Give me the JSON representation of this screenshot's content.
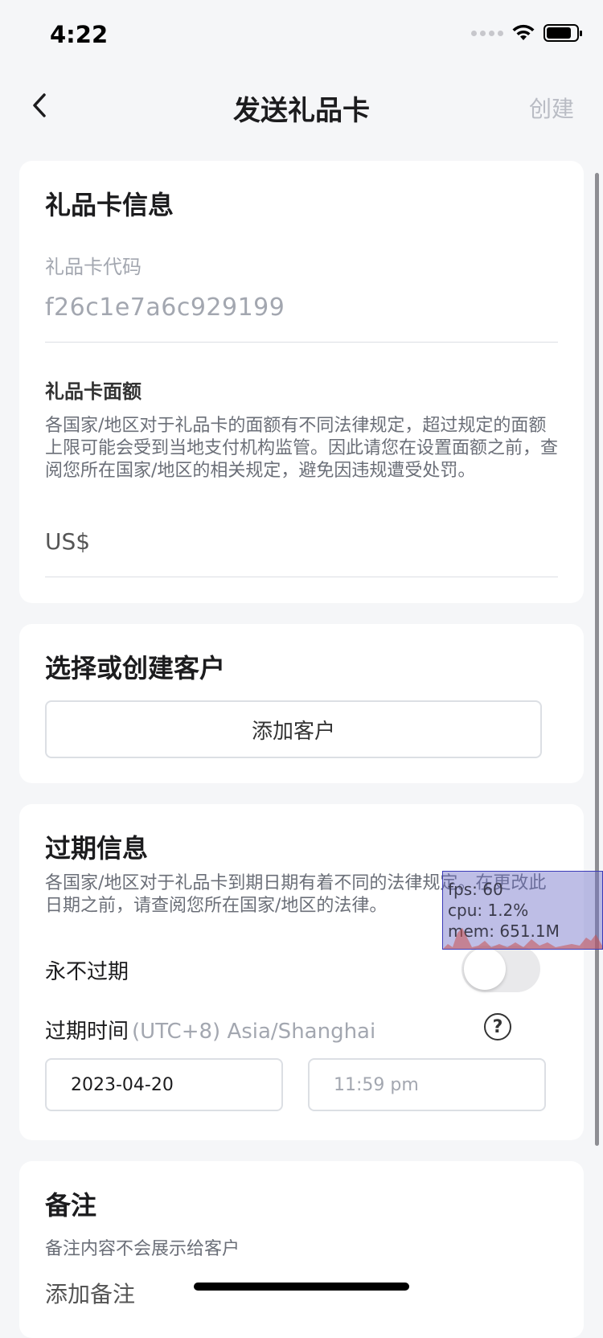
{
  "status_bar": {
    "time": "4:22"
  },
  "nav": {
    "title": "发送礼品卡",
    "action_label": "创建"
  },
  "gift_card_info": {
    "title": "礼品卡信息",
    "code_label": "礼品卡代码",
    "code_value": "f26c1e7a6c929199",
    "amount_label": "礼品卡面额",
    "amount_desc": "各国家/地区对于礼品卡的面额有不同法律规定，超过规定的面额上限可能会受到当地支付机构监管。因此请您在设置面额之前，查阅您所在国家/地区的相关规定，避免因违规遭受处罚。",
    "currency_prefix": "US$"
  },
  "customer": {
    "title": "选择或创建客户",
    "add_button": "添加客户"
  },
  "expiry": {
    "title": "过期信息",
    "desc": "各国家/地区对于礼品卡到期日期有着不同的法律规定。在更改此日期之前，请查阅您所在国家/地区的法律。",
    "never_expire_label": "永不过期",
    "never_expire_on": false,
    "expire_time_label": "过期时间",
    "timezone": "(UTC+8) Asia/Shanghai",
    "date_value": "2023-04-20",
    "time_placeholder": "11:59 pm"
  },
  "note": {
    "title": "备注",
    "hint": "备注内容不会展示给客户",
    "placeholder": "添加备注"
  },
  "perf_overlay": {
    "fps": "fps: 60",
    "cpu": "cpu:   1.2%",
    "mem": "mem: 651.1M"
  },
  "colors": {
    "background": "#f5f6f8",
    "card": "#ffffff",
    "muted_text": "#a3a7b0",
    "border": "#dcdfe4"
  }
}
